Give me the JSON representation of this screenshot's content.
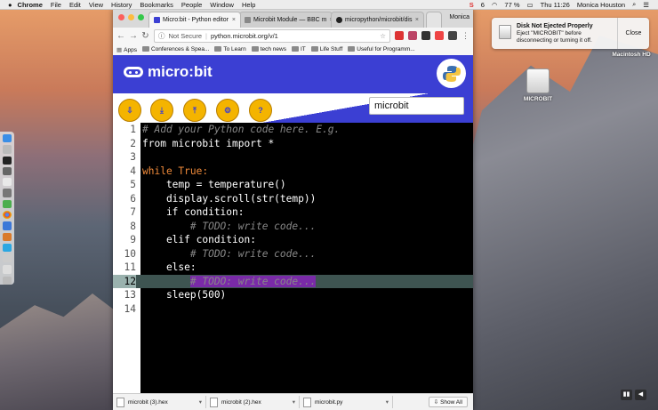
{
  "menubar": {
    "app": "Chrome",
    "items": [
      "File",
      "Edit",
      "View",
      "History",
      "Bookmarks",
      "People",
      "Window",
      "Help"
    ],
    "battery": "77 %",
    "clock": "Thu 11:26",
    "user": "Monica Houston",
    "s_count": "6"
  },
  "notification": {
    "title": "Disk Not Ejected Properly",
    "body": "Eject \"MICROBIT\" before disconnecting or turning it off.",
    "close_label": "Close"
  },
  "desktop": {
    "disk1_label": "Macintosh HD",
    "disk2_label": "MICROBIT"
  },
  "browser": {
    "tabs": [
      {
        "title": "Micro:bit - Python editor",
        "active": true
      },
      {
        "title": "Microbit Module — BBC m",
        "active": false
      },
      {
        "title": "micropython/microbit/dis",
        "active": false
      }
    ],
    "profile": "Monica",
    "omnibox": {
      "security": "Not Secure",
      "url": "python.microbit.org/v/1"
    },
    "bookmarks": [
      "Apps",
      "Conferences & Spea...",
      "To Learn",
      "tech news",
      "IT",
      "Life Stuff",
      "Useful for Programm..."
    ]
  },
  "editor_app": {
    "brand": "micro:bit",
    "script_name": "microbit",
    "toolbar_buttons": [
      {
        "name": "download",
        "glyph": "⇩"
      },
      {
        "name": "save",
        "glyph": "⤓"
      },
      {
        "name": "load",
        "glyph": "⤒"
      },
      {
        "name": "snippets",
        "glyph": "⚙"
      },
      {
        "name": "help",
        "glyph": "?"
      }
    ],
    "code_lines": [
      {
        "n": "1",
        "text": "# Add your Python code here. E.g."
      },
      {
        "n": "2",
        "text": "from microbit import *"
      },
      {
        "n": "3",
        "text": ""
      },
      {
        "n": "4",
        "text": "while True:"
      },
      {
        "n": "5",
        "text": "    temp = temperature()"
      },
      {
        "n": "6",
        "text": "    display.scroll(str(temp))"
      },
      {
        "n": "7",
        "text": "    if condition:"
      },
      {
        "n": "8",
        "text": "        # TODO: write code..."
      },
      {
        "n": "9",
        "text": "    elif condition:"
      },
      {
        "n": "10",
        "text": "        # TODO: write code..."
      },
      {
        "n": "11",
        "text": "    else:"
      },
      {
        "n": "12",
        "text": "        # TODO: write code..."
      },
      {
        "n": "13",
        "text": "    sleep(500)"
      },
      {
        "n": "14",
        "text": ""
      }
    ],
    "selected_line": "12"
  },
  "downloads": {
    "items": [
      "microbit (3).hex",
      "microbit (2).hex",
      "microbit.py"
    ],
    "show_all": "Show All"
  },
  "colors": {
    "brand_blue": "#3b3fd3",
    "button_yellow": "#f4b400",
    "selection_purple": "#7a2aa8"
  }
}
